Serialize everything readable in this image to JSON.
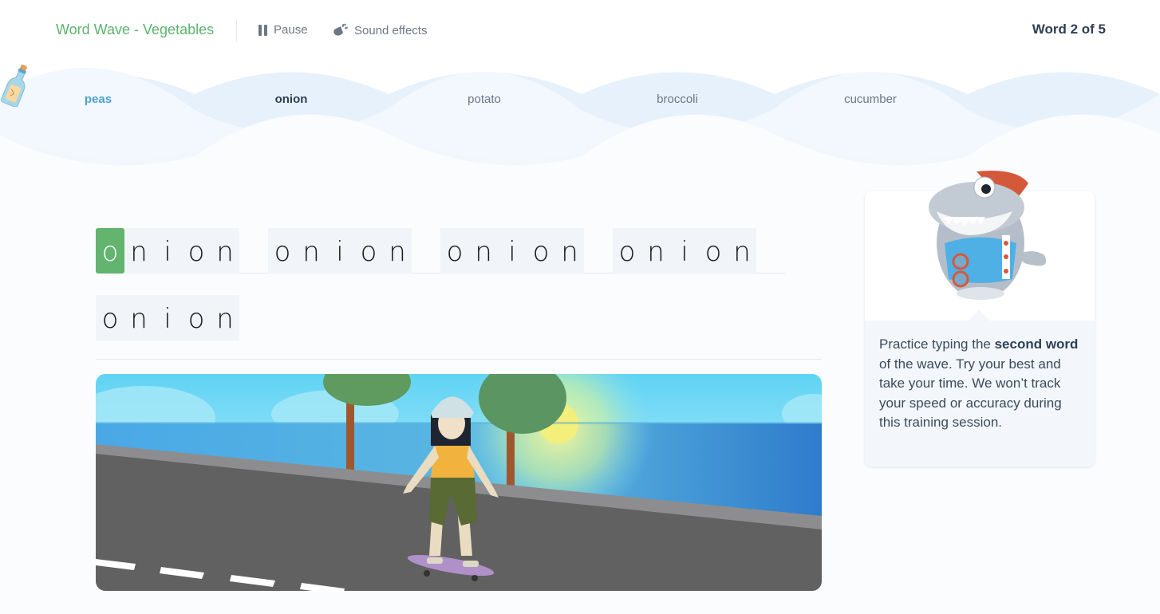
{
  "header": {
    "app_title": "Word Wave - Vegetables",
    "pause_label": "Pause",
    "sound_label": "Sound effects",
    "word_counter": "Word 2 of 5",
    "progress": {
      "current": 2,
      "total": 5
    }
  },
  "wave": {
    "words": [
      {
        "label": "peas",
        "state": "done"
      },
      {
        "label": "onion",
        "state": "current"
      },
      {
        "label": "potato",
        "state": "upcoming"
      },
      {
        "label": "broccoli",
        "state": "upcoming"
      },
      {
        "label": "cucumber",
        "state": "upcoming"
      }
    ]
  },
  "typing": {
    "target_word": "onion",
    "repetitions": 5,
    "active_char_index": 0,
    "words": [
      {
        "chars": [
          "o",
          "n",
          "i",
          "o",
          "n"
        ]
      },
      {
        "chars": [
          "o",
          "n",
          "i",
          "o",
          "n"
        ]
      },
      {
        "chars": [
          "o",
          "n",
          "i",
          "o",
          "n"
        ]
      },
      {
        "chars": [
          "o",
          "n",
          "i",
          "o",
          "n"
        ]
      },
      {
        "chars": [
          "o",
          "n",
          "i",
          "o",
          "n"
        ]
      }
    ]
  },
  "hint": {
    "text_before": "Practice typing the ",
    "bold1": "second word",
    "text_after": " of the wave. Try your best and take your time. We won’t track your speed or accuracy during this training session."
  },
  "colors": {
    "accent_green": "#62b46f",
    "title_green": "#5bb46e",
    "done_blue": "#4aa3cc",
    "text_dark": "#2f3f53",
    "text_muted": "#6b7787"
  }
}
